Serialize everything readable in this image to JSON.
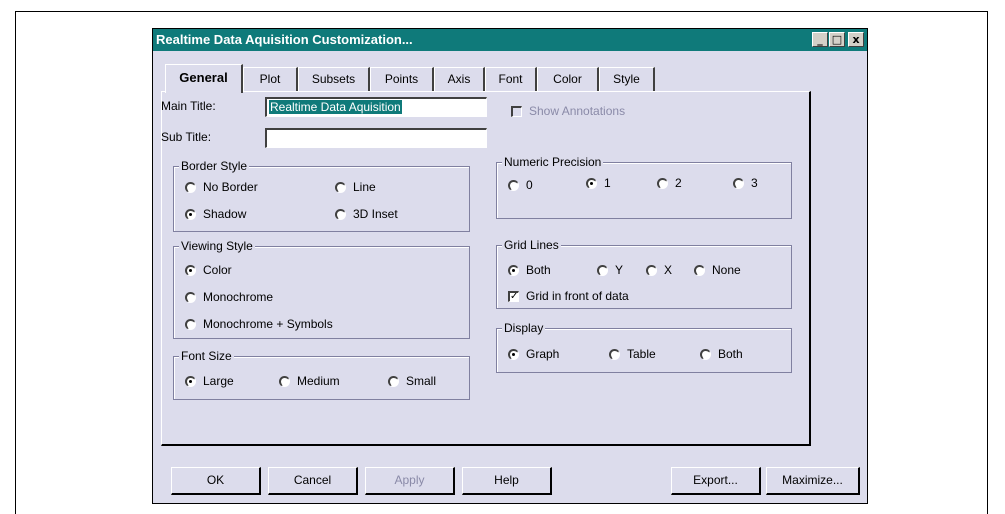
{
  "window": {
    "title": "Realtime Data Aquisition Customization...",
    "controls": {
      "minimize": "_",
      "maximize": "□",
      "close": "x"
    }
  },
  "tabs": [
    "General",
    "Plot",
    "Subsets",
    "Points",
    "Axis",
    "Font",
    "Color",
    "Style"
  ],
  "active_tab": "General",
  "general": {
    "main_title_label": "Main Title:",
    "main_title_value": "Realtime Data Aquisition",
    "sub_title_label": "Sub Title:",
    "sub_title_value": "",
    "show_annotations_label": "Show Annotations",
    "show_annotations_checked": false
  },
  "border_style": {
    "title": "Border Style",
    "options": [
      "No Border",
      "Line",
      "Shadow",
      "3D Inset"
    ],
    "selected": "Shadow"
  },
  "viewing_style": {
    "title": "Viewing Style",
    "options": [
      "Color",
      "Monochrome",
      "Monochrome + Symbols"
    ],
    "selected": "Color"
  },
  "font_size": {
    "title": "Font Size",
    "options": [
      "Large",
      "Medium",
      "Small"
    ],
    "selected": "Large"
  },
  "numeric_precision": {
    "title": "Numeric Precision",
    "options": [
      "0",
      "1",
      "2",
      "3"
    ],
    "selected": "1"
  },
  "grid_lines": {
    "title": "Grid Lines",
    "options": [
      "Both",
      "Y",
      "X",
      "None"
    ],
    "selected": "Both",
    "front_label": "Grid in front of data",
    "front_checked": true
  },
  "display": {
    "title": "Display",
    "options": [
      "Graph",
      "Table",
      "Both"
    ],
    "selected": "Graph"
  },
  "buttons": {
    "ok": "OK",
    "cancel": "Cancel",
    "apply": "Apply",
    "help": "Help",
    "export": "Export...",
    "maximize": "Maximize..."
  }
}
